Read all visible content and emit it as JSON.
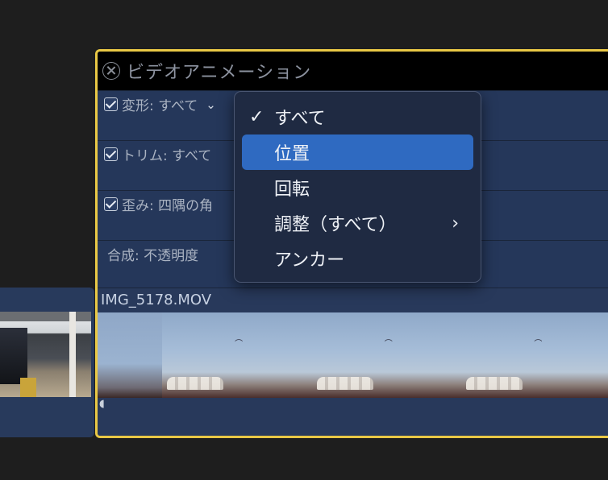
{
  "panel": {
    "title": "ビデオアニメーション",
    "rows": [
      {
        "label": "変形: すべて",
        "checked": true
      },
      {
        "label": "トリム: すべて",
        "checked": true
      },
      {
        "label": "歪み: 四隅の角",
        "checked": true
      },
      {
        "label": "合成: 不透明度",
        "checked": false
      }
    ],
    "chevron": "⌄"
  },
  "clip": {
    "name": "IMG_5178.MOV"
  },
  "menu": {
    "items": [
      {
        "label": "すべて",
        "checked": true,
        "highlighted": false,
        "submenu": false
      },
      {
        "label": "位置",
        "checked": false,
        "highlighted": true,
        "submenu": false
      },
      {
        "label": "回転",
        "checked": false,
        "highlighted": false,
        "submenu": false
      },
      {
        "label": "調整（すべて）",
        "checked": false,
        "highlighted": false,
        "submenu": true
      },
      {
        "label": "アンカー",
        "checked": false,
        "highlighted": false,
        "submenu": false
      }
    ],
    "check_glyph": "✓",
    "submenu_glyph": "›"
  },
  "colors": {
    "selection_border": "#e9c845",
    "menu_highlight": "#2f6ac1",
    "panel_bg": "#243553"
  }
}
